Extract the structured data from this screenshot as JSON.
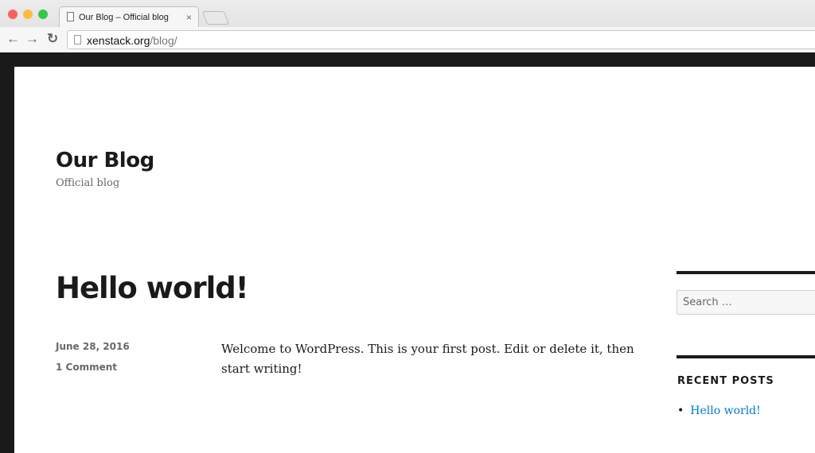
{
  "browser": {
    "tab_title": "Our Blog – Official blog",
    "close": "×",
    "url_host": "xenstack.org",
    "url_path": "/blog/",
    "back": "←",
    "forward": "→",
    "reload": "↻"
  },
  "site": {
    "title": "Our Blog",
    "tagline": "Official blog"
  },
  "post": {
    "title": "Hello world!",
    "date": "June 28, 2016",
    "comments": "1 Comment",
    "content": "Welcome to WordPress. This is your first post. Edit or delete it, then start writing!"
  },
  "sidebar": {
    "search_placeholder": "Search …",
    "recent_title": "RECENT POSTS",
    "recent_posts": [
      {
        "label": "Hello world!"
      }
    ]
  },
  "colors": {
    "link": "#007acc",
    "text": "#1a1a1a",
    "meta": "#686868"
  }
}
